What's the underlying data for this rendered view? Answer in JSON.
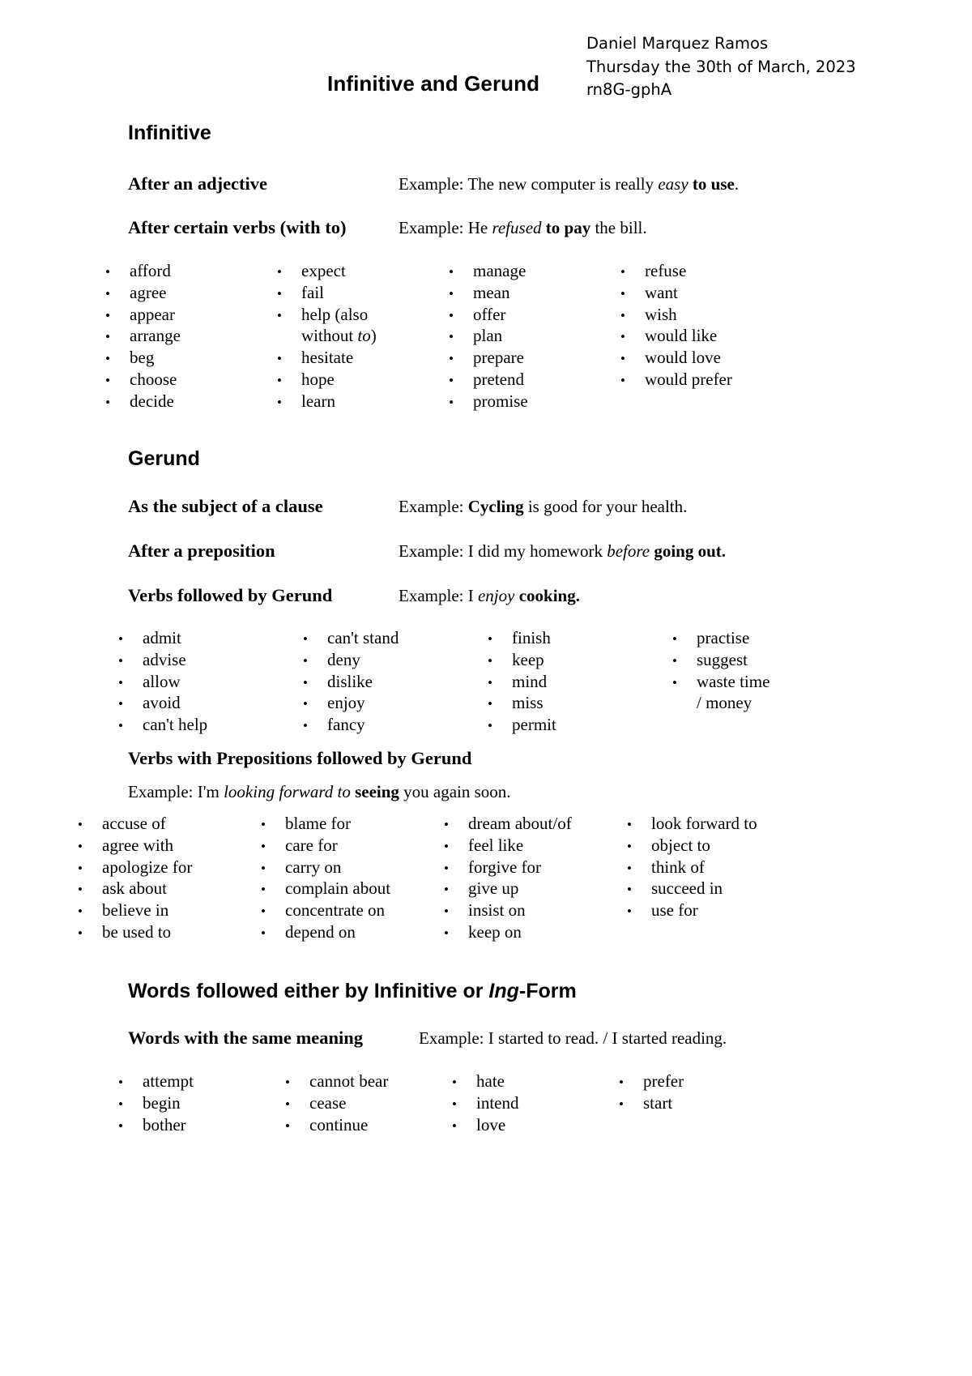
{
  "header": {
    "title": "Infinitive and Gerund",
    "author": "Daniel Marquez Ramos",
    "date": "Thursday the 30th of March, 2023",
    "code": "rn8G-gphA"
  },
  "sections": {
    "infinitive": {
      "heading": "Infinitive",
      "rows": [
        {
          "label": "After an adjective",
          "example_html": "Example:  The new computer is really <i>easy</i> <b>to use</b>."
        },
        {
          "label": "After certain verbs (with to)",
          "example_html": "Example: He <i>refused</i> <b>to pay</b> the bill."
        }
      ],
      "columns": [
        [
          "afford",
          "agree",
          "appear",
          "arrange",
          "beg",
          "choose",
          "decide"
        ],
        [
          "expect",
          "fail",
          "help (also",
          "without <i>to</i>)",
          "hesitate",
          "hope",
          "learn"
        ],
        [
          "manage",
          "mean",
          "offer",
          "plan",
          "prepare",
          "pretend",
          "promise"
        ],
        [
          "refuse",
          "want",
          "wish",
          "would like",
          "would love",
          "would prefer"
        ]
      ],
      "continuation_cells": [
        [],
        [
          3
        ],
        [],
        []
      ]
    },
    "gerund": {
      "heading": "Gerund",
      "rows": [
        {
          "label": "As the subject of a clause",
          "example_html": "Example: <b>Cycling</b> is good for your health."
        },
        {
          "label": "After a preposition",
          "example_html": "Example:  I did my homework <i>before</i> <b>going out.</b>"
        },
        {
          "label": "Verbs followed by Gerund",
          "example_html": "Example: I <i>enjoy</i> <b>cooking.</b>"
        }
      ],
      "columns": [
        [
          "admit",
          "advise",
          "allow",
          "avoid",
          "can't help"
        ],
        [
          "can't stand",
          "deny",
          "dislike",
          "enjoy",
          "fancy"
        ],
        [
          "finish",
          "keep",
          "mind",
          "miss",
          "permit"
        ],
        [
          "practise",
          "suggest",
          "waste time",
          "/ money"
        ]
      ],
      "continuation_cells": [
        [],
        [],
        [],
        [
          3
        ]
      ]
    },
    "prepositions": {
      "heading": "Verbs with Prepositions followed by Gerund",
      "example_html": "Example: I'm <i>looking forward to</i> <b>seeing</b> you again soon.",
      "columns": [
        [
          "accuse of",
          "agree with",
          "apologize for",
          "ask about",
          "believe in",
          "be used to"
        ],
        [
          "blame for",
          "care for",
          "carry on",
          "complain about",
          "concentrate on",
          "depend on"
        ],
        [
          "dream about/of",
          "feel like",
          "forgive for",
          "give up",
          "insist on",
          "keep on"
        ],
        [
          "look forward to",
          "object to",
          "think of",
          "succeed in",
          "use for"
        ]
      ]
    },
    "either": {
      "heading_html": "Words followed either by Infinitive or <em>Ing</em>-Form",
      "rows": [
        {
          "label": "Words with the same meaning",
          "example_html": "Example: I started to read. / I started reading."
        }
      ],
      "columns": [
        [
          "attempt",
          "begin",
          "bother"
        ],
        [
          "cannot bear",
          "cease",
          "continue"
        ],
        [
          "hate",
          "intend",
          "love"
        ],
        [
          "prefer",
          "start"
        ]
      ]
    }
  },
  "bullet_glyph": "•"
}
